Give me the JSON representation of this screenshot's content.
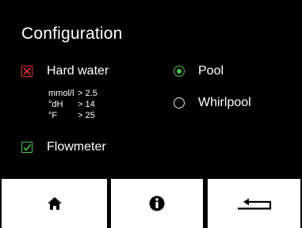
{
  "header": {
    "title": "Configuration"
  },
  "options": {
    "hard_water": {
      "label": "Hard water",
      "checked": true,
      "color": "#e0312b"
    },
    "flowmeter": {
      "label": "Flowmeter",
      "checked": true,
      "color": "#4cc24a"
    }
  },
  "hardness": [
    {
      "unit": "mmol/l",
      "value": "> 2.5"
    },
    {
      "unit": "°dH",
      "value": "> 14"
    },
    {
      "unit": "°F",
      "value": "> 25"
    }
  ],
  "mode": {
    "pool": {
      "label": "Pool",
      "selected": true
    },
    "whirlpool": {
      "label": "Whirlpool",
      "selected": false
    }
  },
  "buttons": [
    {
      "icon": "home-icon"
    },
    {
      "icon": "info-icon"
    },
    {
      "icon": "back-arrow-icon"
    }
  ],
  "colors": {
    "background": "#000000",
    "accent_green": "#4cc24a",
    "accent_red": "#e0312b",
    "button_bg": "#ffffff"
  }
}
